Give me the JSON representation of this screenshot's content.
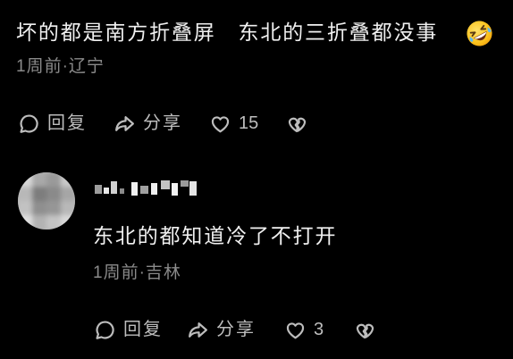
{
  "comment": {
    "text": "坏的都是南方折叠屏　东北的三折叠都没事",
    "emoji_icon": "rolling-on-floor-laughing-emoji",
    "meta": "1周前·辽宁",
    "actions": {
      "reply_label": "回复",
      "share_label": "分享",
      "like_count": "15",
      "reply_icon": "comment-bubble-icon",
      "share_icon": "share-arrow-icon",
      "like_icon": "heart-outline-icon",
      "dislike_icon": "broken-heart-icon"
    }
  },
  "reply": {
    "text": "东北的都知道冷了不打开",
    "meta": "1周前·吉林",
    "actions": {
      "reply_label": "回复",
      "share_label": "分享",
      "like_count": "3",
      "reply_icon": "comment-bubble-icon",
      "share_icon": "share-arrow-icon",
      "like_icon": "heart-outline-icon",
      "dislike_icon": "broken-heart-icon"
    }
  },
  "colors": {
    "background": "#000000",
    "primary_text": "#f0f0f0",
    "secondary_text": "#8a8a8a",
    "icon": "#bdbdbd"
  }
}
